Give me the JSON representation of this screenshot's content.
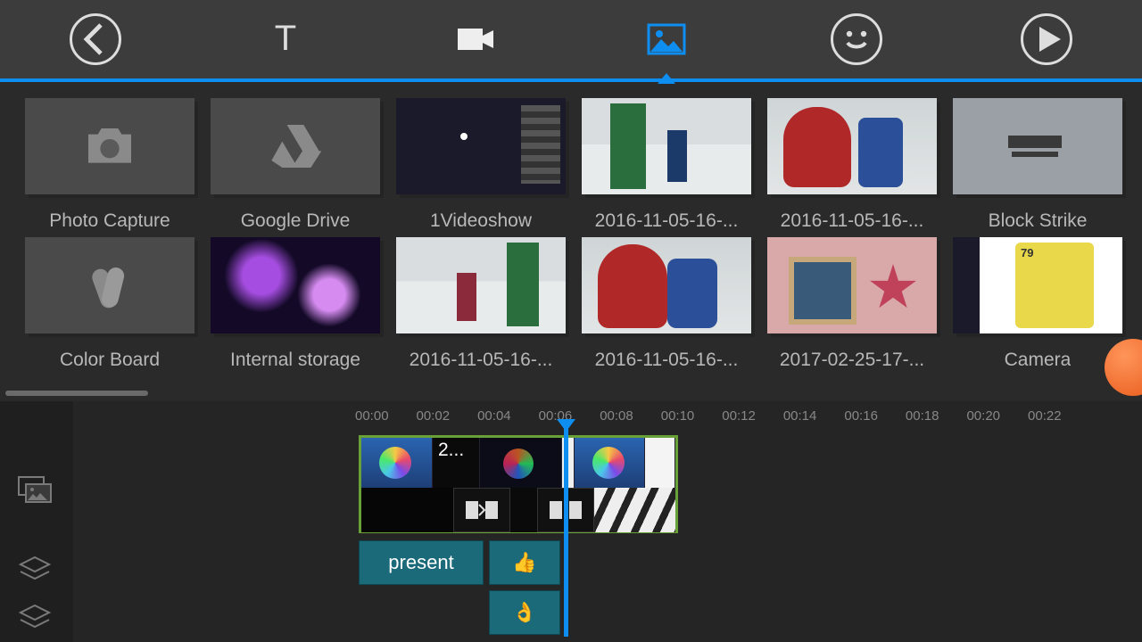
{
  "toolbar": {
    "tabs": [
      "back",
      "text",
      "video",
      "image",
      "emoji",
      "play"
    ],
    "active": "image"
  },
  "gallery": {
    "row1": [
      {
        "label": "Photo Capture",
        "kind": "folder",
        "icon": "camera"
      },
      {
        "label": "Google Drive",
        "kind": "folder",
        "icon": "drive"
      },
      {
        "label": "1Videoshow",
        "kind": "thumb",
        "art": "dark"
      },
      {
        "label": "2016-11-05-16-...",
        "kind": "thumb",
        "art": "snow"
      },
      {
        "label": "2016-11-05-16-...",
        "kind": "thumb",
        "art": "bear"
      },
      {
        "label": "Block Strike",
        "kind": "thumb",
        "art": "gun"
      }
    ],
    "row2": [
      {
        "label": "Color Board",
        "kind": "folder",
        "icon": "swatch"
      },
      {
        "label": "Internal storage",
        "kind": "thumb",
        "art": "nebula"
      },
      {
        "label": "2016-11-05-16-...",
        "kind": "thumb",
        "art": "snow2"
      },
      {
        "label": "2016-11-05-16-...",
        "kind": "thumb",
        "art": "bear2"
      },
      {
        "label": "2017-02-25-17-...",
        "kind": "thumb",
        "art": "craft"
      },
      {
        "label": "Camera",
        "kind": "thumb",
        "art": "fifa"
      }
    ]
  },
  "timeline": {
    "ticks": [
      "00:00",
      "00:02",
      "00:04",
      "00:06",
      "00:08",
      "00:10",
      "00:12",
      "00:14",
      "00:16",
      "00:18",
      "00:20",
      "00:22"
    ],
    "clip_label": "2...",
    "overlay_text": "present",
    "playhead_time": "00:06"
  }
}
